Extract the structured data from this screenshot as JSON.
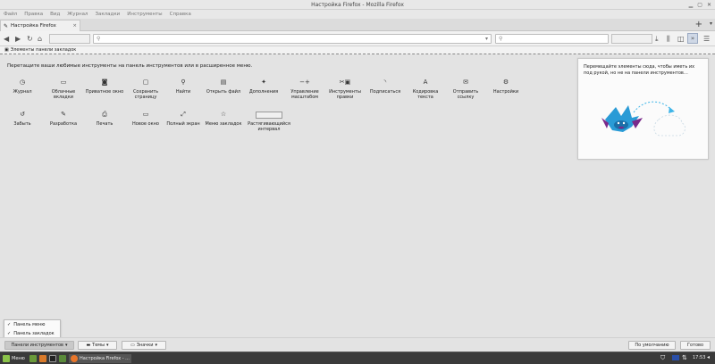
{
  "window": {
    "title": "Настройка Firefox - Mozilla Firefox"
  },
  "menubar": [
    "Файл",
    "Правка",
    "Вид",
    "Журнал",
    "Закладки",
    "Инструменты",
    "Справка"
  ],
  "tab": {
    "label": "Настройка Firefox",
    "close": "×"
  },
  "newtab": "+",
  "tabs_menu": "▾",
  "bookmarks": {
    "label": "Элементы панели закладок"
  },
  "instructions": "Перетащите ваши любимые инструменты на панель инструментов или в расширенное меню.",
  "palette": [
    {
      "id": "history",
      "icon": "◷",
      "label": "Журнал"
    },
    {
      "id": "cloud-tabs",
      "icon": "▭",
      "label": "Облачные вкладки"
    },
    {
      "id": "private",
      "icon": "◙",
      "label": "Приватное окно"
    },
    {
      "id": "save-page",
      "icon": "▢",
      "label": "Сохранить страницу"
    },
    {
      "id": "find",
      "icon": "⚲",
      "label": "Найти"
    },
    {
      "id": "open-file",
      "icon": "▤",
      "label": "Открыть файл"
    },
    {
      "id": "addons",
      "icon": "✦",
      "label": "Дополнения"
    },
    {
      "id": "zoom",
      "icon": "−+",
      "label": "Управление масштабом"
    },
    {
      "id": "edit",
      "icon": "✂▣",
      "label": "Инструменты правки"
    },
    {
      "id": "subscribe",
      "icon": "◝",
      "label": "Подписаться"
    },
    {
      "id": "encoding",
      "icon": "A",
      "label": "Кодировка текста"
    },
    {
      "id": "email-link",
      "icon": "✉",
      "label": "Отправить ссылку"
    },
    {
      "id": "settings",
      "icon": "⚙",
      "label": "Настройки"
    },
    {
      "id": "forget",
      "icon": "↺",
      "label": "Забыть"
    },
    {
      "id": "developer",
      "icon": "✎",
      "label": "Разработка"
    },
    {
      "id": "print",
      "icon": "⎙",
      "label": "Печать"
    },
    {
      "id": "new-window",
      "icon": "▭",
      "label": "Новое окно"
    },
    {
      "id": "fullscreen",
      "icon": "⤢",
      "label": "Полный экран"
    },
    {
      "id": "bookmarks-menu",
      "icon": "☆",
      "label": "Меню закладок"
    },
    {
      "id": "flexible-space",
      "icon": "",
      "label": "Растягивающийся интервал"
    }
  ],
  "panel": {
    "text": "Перемещайте элементы сюда, чтобы иметь их под рукой, но не на панели инструментов…"
  },
  "footer": {
    "toolbars": "Панели инструментов",
    "themes": "Темы",
    "icons": "Значки",
    "restore": "По умолчанию",
    "done": "Готово"
  },
  "popup": [
    "Панель меню",
    "Панель закладок"
  ],
  "taskbar": {
    "menu": "Меню",
    "window": "Настройка Firefox - ...",
    "time": "17:53"
  },
  "colors": {
    "accent": "#3fb5e8",
    "mascot": "#2a9bd6",
    "mascot_dark": "#7a2a8a",
    "taskbar": "#3a3a3a"
  }
}
